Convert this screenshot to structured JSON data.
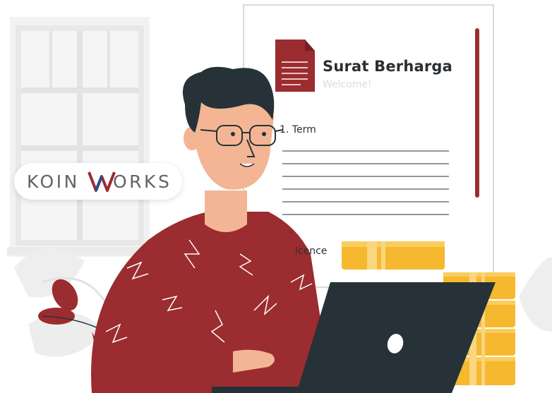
{
  "document": {
    "title": "Surat Berharga",
    "subtitle": "Welcome!",
    "term_item": "1. Term",
    "licence_fragment": "icence"
  },
  "brand": {
    "logo_text_left": "KOIN",
    "logo_text_right": "ORKS",
    "colors": {
      "brand_red": "#9b2c2f",
      "brand_blue": "#2b4f8f",
      "text_gray": "#5e6368"
    }
  },
  "colors": {
    "sweater": "#9b2c2f",
    "laptop": "#263238",
    "coins": "#f5b82e",
    "skin": "#f4b594",
    "hair": "#263238"
  }
}
